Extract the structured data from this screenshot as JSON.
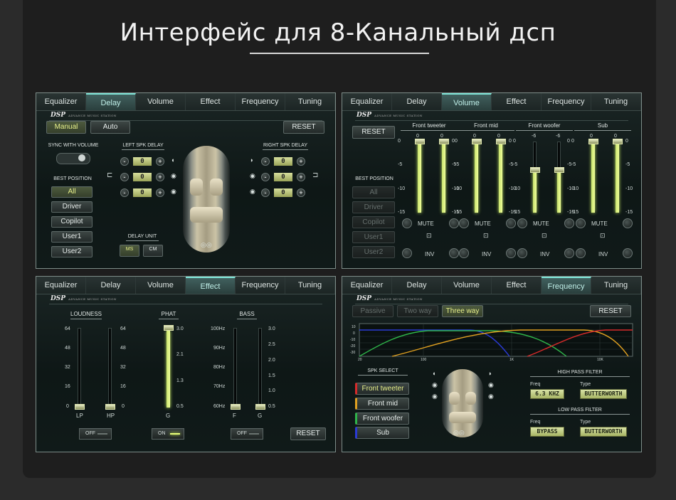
{
  "header": {
    "title": "Интерфейс для 8-Канальный дсп"
  },
  "tabs": [
    "Equalizer",
    "Delay",
    "Volume",
    "Effect",
    "Frequency",
    "Tuning"
  ],
  "brand": {
    "logo": "DSP",
    "subtitle": "ADVANCE MUSIC STATION"
  },
  "colors": {
    "accent": "#e7f08a",
    "active_tab": "#7ee3d6",
    "bg": "#0e1716",
    "tweeter": "#d62a2a",
    "mid": "#e0a020",
    "woofer": "#2fb54a",
    "sub": "#2a3ad6"
  },
  "delay": {
    "active_tab": "Delay",
    "mode_manual": "Manual",
    "mode_auto": "Auto",
    "reset": "RESET",
    "sync_label": "SYNC WITH VOLUME",
    "best_position_label": "BEST POSITION",
    "positions": [
      "All",
      "Driver",
      "Copilot",
      "User1",
      "User2"
    ],
    "left_label": "LEFT SPK DELAY",
    "right_label": "RIGHT SPK DELAY",
    "minus": "-",
    "plus": "+",
    "left_values": [
      "0",
      "0",
      "0"
    ],
    "right_values": [
      "0",
      "0",
      "0"
    ],
    "unit_label": "DELAY UNIT",
    "unit_ms": "MS",
    "unit_cm": "CM"
  },
  "volume": {
    "active_tab": "Volume",
    "reset": "RESET",
    "best_position_label": "BEST POSITION",
    "positions": [
      "All",
      "Driver",
      "Copilot",
      "User1",
      "User2"
    ],
    "groups": [
      {
        "name": "Front tweeter",
        "left": "0",
        "right": "0",
        "left_level": 0,
        "right_level": 0
      },
      {
        "name": "Front mid",
        "left": "0",
        "right": "0",
        "left_level": 0,
        "right_level": 0
      },
      {
        "name": "Front woofer",
        "left": "-6",
        "right": "-6",
        "left_level": -6,
        "right_level": -6
      },
      {
        "name": "Sub",
        "left": "0",
        "right": "0",
        "left_level": 0,
        "right_level": 0
      }
    ],
    "scale": [
      "0",
      "-5",
      "-10",
      "-15"
    ],
    "mute": "MUTE",
    "inv": "INV"
  },
  "effect": {
    "active_tab": "Effect",
    "loudness": {
      "label": "LOUDNESS",
      "ticks": [
        "64",
        "48",
        "32",
        "16",
        "0"
      ],
      "lp": "LP",
      "hp": "HP",
      "switch": "OFF"
    },
    "phat": {
      "label": "PHAT",
      "ticks": [
        "3.0",
        "2.1",
        "1.3",
        "0.5"
      ],
      "g": "G",
      "switch": "ON",
      "level": 3.0
    },
    "bass": {
      "label": "BASS",
      "freq_ticks": [
        "100Hz",
        "90Hz",
        "80Hz",
        "70Hz",
        "60Hz"
      ],
      "gain_ticks": [
        "3.0",
        "2.5",
        "2.0",
        "1.5",
        "1.0",
        "0.5"
      ],
      "f": "F",
      "g": "G",
      "switch": "OFF"
    },
    "reset": "RESET"
  },
  "frequency": {
    "active_tab": "Frequency",
    "modes": [
      "Passive",
      "Two way",
      "Three way"
    ],
    "reset": "RESET",
    "graph_y": [
      "10",
      "0",
      "-10",
      "-20",
      "-30"
    ],
    "graph_x": [
      "20",
      "100",
      "1K",
      "10K"
    ],
    "spk_select_label": "SPK SELECT",
    "speakers": [
      "Front tweeter",
      "Front mid",
      "Front woofer",
      "Sub"
    ],
    "hpf_label": "HIGH PASS FILTER",
    "lpf_label": "LOW PASS FILTER",
    "freq_label": "Freq",
    "type_label": "Type",
    "hpf_freq": "6.3 KHZ",
    "hpf_type": "BUTTERWORTH",
    "lpf_freq": "BYPASS",
    "lpf_type": "BUTTERWORTH"
  }
}
